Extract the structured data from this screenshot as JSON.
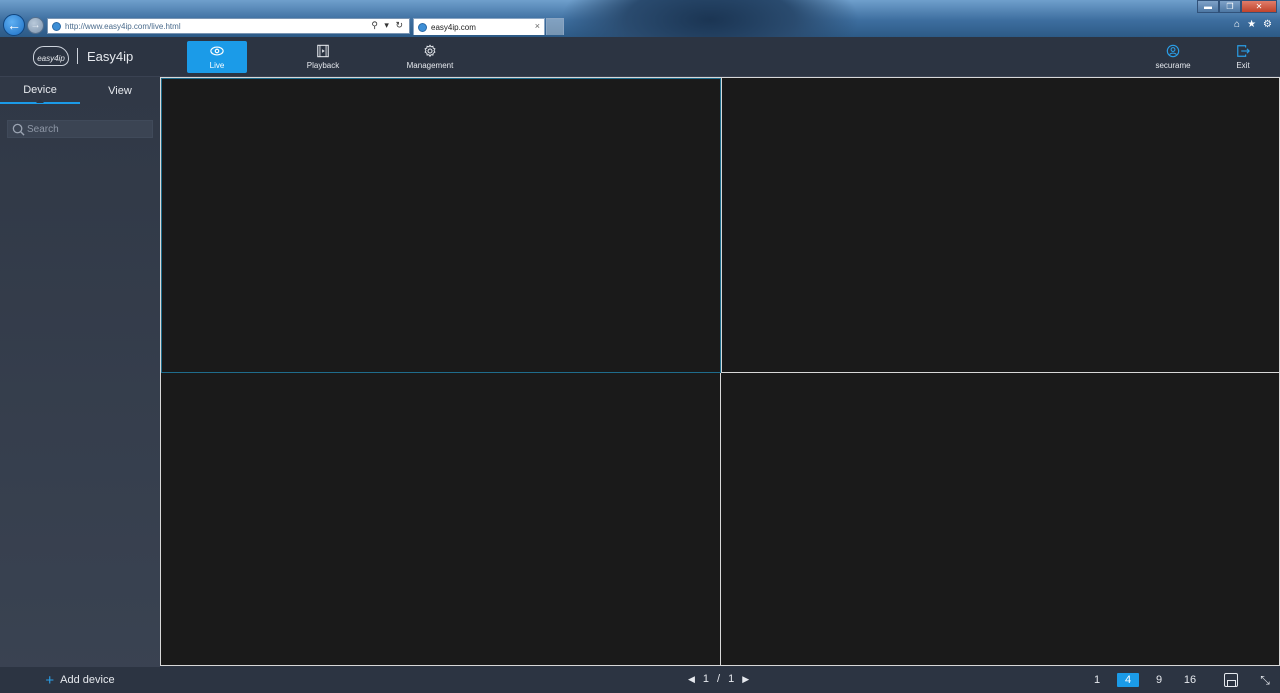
{
  "browser": {
    "url": "http://www.easy4ip.com/live.html",
    "tab_title": "easy4ip.com",
    "tab_close": "×",
    "back": "←",
    "forward": "→",
    "address_tools": "⚲ ▾ ↻",
    "window_controls": {
      "minimize": "▬",
      "restore": "❐",
      "close": "✕"
    },
    "icons": {
      "home": "⌂",
      "favorites": "★",
      "settings": "⚙"
    }
  },
  "app": {
    "logo_text": "easy4ip",
    "brand": "Easy4ip",
    "nav": {
      "live": "Live",
      "playback": "Playback",
      "management": "Management",
      "user": "securame",
      "exit": "Exit"
    },
    "active_nav": "Live",
    "accent_color": "#1b9be8"
  },
  "sidebar": {
    "tabs": {
      "device": "Device",
      "view": "View"
    },
    "active_tab": "Device",
    "search_placeholder": "Search",
    "add_device": "Add device",
    "add_icon": "+"
  },
  "grid": {
    "layout": 4
  },
  "bottom": {
    "pager": {
      "prev": "◀",
      "current": "1",
      "separator": "/",
      "total": "1",
      "next": "▶"
    },
    "layouts": [
      {
        "label": "1",
        "active": false
      },
      {
        "label": "4",
        "active": true
      },
      {
        "label": "9",
        "active": false
      },
      {
        "label": "16",
        "active": false
      }
    ],
    "fullscreen_icon": "⤡"
  }
}
